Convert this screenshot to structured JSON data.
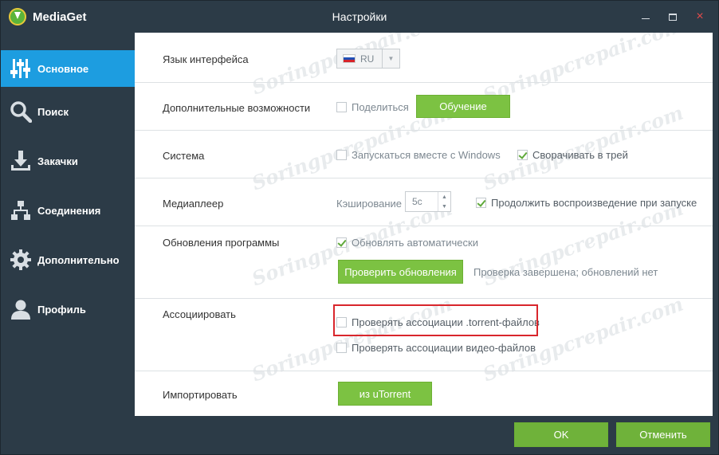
{
  "app": {
    "name": "MediaGet",
    "window_title": "Настройки"
  },
  "window_controls": {
    "minimize": "minimize",
    "maximize": "maximize",
    "close": "×"
  },
  "sidebar": {
    "items": [
      {
        "label": "Основное",
        "icon": "sliders-icon",
        "active": true
      },
      {
        "label": "Поиск",
        "icon": "search-icon",
        "active": false
      },
      {
        "label": "Закачки",
        "icon": "download-icon",
        "active": false
      },
      {
        "label": "Соединения",
        "icon": "network-icon",
        "active": false
      },
      {
        "label": "Дополнительно",
        "icon": "gear-icon",
        "active": false
      },
      {
        "label": "Профиль",
        "icon": "user-icon",
        "active": false
      }
    ]
  },
  "settings": {
    "language": {
      "label": "Язык интерфейса",
      "value": "RU"
    },
    "extras": {
      "label": "Дополнительные возможности",
      "share_label": "Поделиться",
      "share_checked": false,
      "tutorial_button": "Обучение"
    },
    "system": {
      "label": "Система",
      "autostart_label": "Запускаться вместе с Windows",
      "autostart_checked": false,
      "tray_label": "Сворачивать в трей",
      "tray_checked": true
    },
    "player": {
      "label": "Медиаплеер",
      "caching_label": "Кэширование",
      "caching_value": "5с",
      "resume_label": "Продолжить воспроизведение при запуске",
      "resume_checked": true
    },
    "updates": {
      "label": "Обновления программы",
      "auto_label": "Обновлять автоматически",
      "auto_checked": true,
      "check_button": "Проверить обновления",
      "status": "Проверка завершена; обновлений нет"
    },
    "associate": {
      "label": "Ассоциировать",
      "torrent_label": "Проверять ассоциации .torrent-файлов",
      "torrent_checked": false,
      "video_label": "Проверять ассоциации видео-файлов",
      "video_checked": false
    },
    "import": {
      "label": "Импортировать",
      "utorrent_button": "из uTorrent"
    }
  },
  "footer": {
    "ok": "OK",
    "cancel": "Отменить"
  },
  "watermark": "Soringpcrepair.com",
  "colors": {
    "accent_blue": "#1d9de0",
    "green_button": "#7cc242",
    "dark_bg": "#2c3b47",
    "highlight_red": "#d9262c"
  }
}
